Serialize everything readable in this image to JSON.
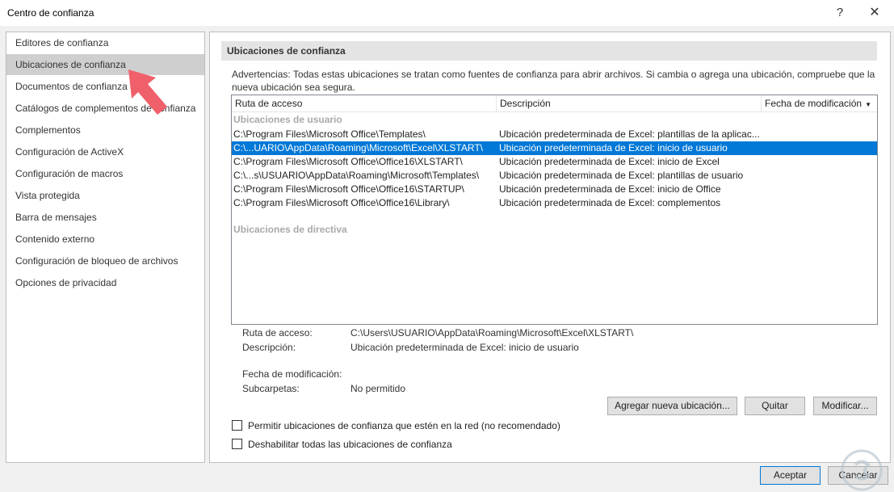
{
  "window": {
    "title": "Centro de confianza",
    "help": "?",
    "close": "✕"
  },
  "sidebar": {
    "items": [
      {
        "label": "Editores de confianza",
        "selected": false
      },
      {
        "label": "Ubicaciones de confianza",
        "selected": true
      },
      {
        "label": "Documentos de confianza",
        "selected": false
      },
      {
        "label": "Catálogos de complementos de confianza",
        "selected": false
      },
      {
        "label": "Complementos",
        "selected": false
      },
      {
        "label": "Configuración de ActiveX",
        "selected": false
      },
      {
        "label": "Configuración de macros",
        "selected": false
      },
      {
        "label": "Vista protegida",
        "selected": false
      },
      {
        "label": "Barra de mensajes",
        "selected": false
      },
      {
        "label": "Contenido externo",
        "selected": false
      },
      {
        "label": "Configuración de bloqueo de archivos",
        "selected": false
      },
      {
        "label": "Opciones de privacidad",
        "selected": false
      }
    ]
  },
  "main": {
    "section_title": "Ubicaciones de confianza",
    "warning": "Advertencias: Todas estas ubicaciones se tratan como fuentes de confianza para abrir archivos. Si cambia o agrega una ubicación, compruebe que la nueva ubicación sea segura.",
    "table": {
      "columns": [
        "Ruta de acceso",
        "Descripción",
        "Fecha de modificación"
      ],
      "sort_indicator": "▼",
      "user_group_label": "Ubicaciones de usuario",
      "policy_group_label": "Ubicaciones de directiva",
      "rows": [
        {
          "path": "C:\\Program Files\\Microsoft Office\\Templates\\",
          "description": "Ubicación predeterminada de Excel: plantillas de la aplicac...",
          "selected": false
        },
        {
          "path": "C:\\...UARIO\\AppData\\Roaming\\Microsoft\\Excel\\XLSTART\\",
          "description": "Ubicación predeterminada de Excel: inicio de usuario",
          "selected": true
        },
        {
          "path": "C:\\Program Files\\Microsoft Office\\Office16\\XLSTART\\",
          "description": "Ubicación predeterminada de Excel: inicio de Excel",
          "selected": false
        },
        {
          "path": "C:\\...s\\USUARIO\\AppData\\Roaming\\Microsoft\\Templates\\",
          "description": "Ubicación predeterminada de Excel: plantillas de usuario",
          "selected": false
        },
        {
          "path": "C:\\Program Files\\Microsoft Office\\Office16\\STARTUP\\",
          "description": "Ubicación predeterminada de Excel: inicio de Office",
          "selected": false
        },
        {
          "path": "C:\\Program Files\\Microsoft Office\\Office16\\Library\\",
          "description": "Ubicación predeterminada de Excel: complementos",
          "selected": false
        }
      ]
    },
    "details": {
      "path_label": "Ruta de acceso:",
      "path_value": "C:\\Users\\USUARIO\\AppData\\Roaming\\Microsoft\\Excel\\XLSTART\\",
      "description_label": "Descripción:",
      "description_value": "Ubicación predeterminada de Excel: inicio de usuario",
      "date_label": "Fecha de modificación:",
      "date_value": "",
      "subfolders_label": "Subcarpetas:",
      "subfolders_value": "No permitido"
    },
    "buttons": {
      "add": "Agregar nueva ubicación...",
      "remove": "Quitar",
      "modify": "Modificar..."
    },
    "checkboxes": {
      "allow_network": {
        "label": "Permitir ubicaciones de confianza que estén en la red (no recomendado)",
        "checked": false
      },
      "disable_all": {
        "label": "Deshabilitar todas las ubicaciones de confianza",
        "checked": false
      }
    }
  },
  "footer": {
    "ok": "Aceptar",
    "cancel": "Cancelar"
  },
  "colors": {
    "selection": "#0078d7",
    "arrow": "#f0606a",
    "sidebar_selected": "#cfcfcf"
  },
  "annotations": {
    "pointer_arrow_icon": "arrow-pointer-icon",
    "watermark_icon": "site-logo-icon"
  }
}
